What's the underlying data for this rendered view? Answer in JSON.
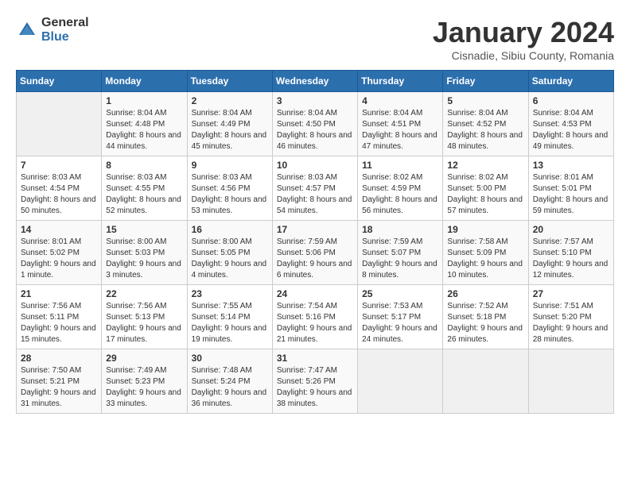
{
  "header": {
    "logo_general": "General",
    "logo_blue": "Blue",
    "title": "January 2024",
    "subtitle": "Cisnadie, Sibiu County, Romania"
  },
  "days_of_week": [
    "Sunday",
    "Monday",
    "Tuesday",
    "Wednesday",
    "Thursday",
    "Friday",
    "Saturday"
  ],
  "weeks": [
    [
      {
        "day": "",
        "sunrise": "",
        "sunset": "",
        "daylight": "",
        "empty": true
      },
      {
        "day": "1",
        "sunrise": "Sunrise: 8:04 AM",
        "sunset": "Sunset: 4:48 PM",
        "daylight": "Daylight: 8 hours and 44 minutes."
      },
      {
        "day": "2",
        "sunrise": "Sunrise: 8:04 AM",
        "sunset": "Sunset: 4:49 PM",
        "daylight": "Daylight: 8 hours and 45 minutes."
      },
      {
        "day": "3",
        "sunrise": "Sunrise: 8:04 AM",
        "sunset": "Sunset: 4:50 PM",
        "daylight": "Daylight: 8 hours and 46 minutes."
      },
      {
        "day": "4",
        "sunrise": "Sunrise: 8:04 AM",
        "sunset": "Sunset: 4:51 PM",
        "daylight": "Daylight: 8 hours and 47 minutes."
      },
      {
        "day": "5",
        "sunrise": "Sunrise: 8:04 AM",
        "sunset": "Sunset: 4:52 PM",
        "daylight": "Daylight: 8 hours and 48 minutes."
      },
      {
        "day": "6",
        "sunrise": "Sunrise: 8:04 AM",
        "sunset": "Sunset: 4:53 PM",
        "daylight": "Daylight: 8 hours and 49 minutes."
      }
    ],
    [
      {
        "day": "7",
        "sunrise": "Sunrise: 8:03 AM",
        "sunset": "Sunset: 4:54 PM",
        "daylight": "Daylight: 8 hours and 50 minutes."
      },
      {
        "day": "8",
        "sunrise": "Sunrise: 8:03 AM",
        "sunset": "Sunset: 4:55 PM",
        "daylight": "Daylight: 8 hours and 52 minutes."
      },
      {
        "day": "9",
        "sunrise": "Sunrise: 8:03 AM",
        "sunset": "Sunset: 4:56 PM",
        "daylight": "Daylight: 8 hours and 53 minutes."
      },
      {
        "day": "10",
        "sunrise": "Sunrise: 8:03 AM",
        "sunset": "Sunset: 4:57 PM",
        "daylight": "Daylight: 8 hours and 54 minutes."
      },
      {
        "day": "11",
        "sunrise": "Sunrise: 8:02 AM",
        "sunset": "Sunset: 4:59 PM",
        "daylight": "Daylight: 8 hours and 56 minutes."
      },
      {
        "day": "12",
        "sunrise": "Sunrise: 8:02 AM",
        "sunset": "Sunset: 5:00 PM",
        "daylight": "Daylight: 8 hours and 57 minutes."
      },
      {
        "day": "13",
        "sunrise": "Sunrise: 8:01 AM",
        "sunset": "Sunset: 5:01 PM",
        "daylight": "Daylight: 8 hours and 59 minutes."
      }
    ],
    [
      {
        "day": "14",
        "sunrise": "Sunrise: 8:01 AM",
        "sunset": "Sunset: 5:02 PM",
        "daylight": "Daylight: 9 hours and 1 minute."
      },
      {
        "day": "15",
        "sunrise": "Sunrise: 8:00 AM",
        "sunset": "Sunset: 5:03 PM",
        "daylight": "Daylight: 9 hours and 3 minutes."
      },
      {
        "day": "16",
        "sunrise": "Sunrise: 8:00 AM",
        "sunset": "Sunset: 5:05 PM",
        "daylight": "Daylight: 9 hours and 4 minutes."
      },
      {
        "day": "17",
        "sunrise": "Sunrise: 7:59 AM",
        "sunset": "Sunset: 5:06 PM",
        "daylight": "Daylight: 9 hours and 6 minutes."
      },
      {
        "day": "18",
        "sunrise": "Sunrise: 7:59 AM",
        "sunset": "Sunset: 5:07 PM",
        "daylight": "Daylight: 9 hours and 8 minutes."
      },
      {
        "day": "19",
        "sunrise": "Sunrise: 7:58 AM",
        "sunset": "Sunset: 5:09 PM",
        "daylight": "Daylight: 9 hours and 10 minutes."
      },
      {
        "day": "20",
        "sunrise": "Sunrise: 7:57 AM",
        "sunset": "Sunset: 5:10 PM",
        "daylight": "Daylight: 9 hours and 12 minutes."
      }
    ],
    [
      {
        "day": "21",
        "sunrise": "Sunrise: 7:56 AM",
        "sunset": "Sunset: 5:11 PM",
        "daylight": "Daylight: 9 hours and 15 minutes."
      },
      {
        "day": "22",
        "sunrise": "Sunrise: 7:56 AM",
        "sunset": "Sunset: 5:13 PM",
        "daylight": "Daylight: 9 hours and 17 minutes."
      },
      {
        "day": "23",
        "sunrise": "Sunrise: 7:55 AM",
        "sunset": "Sunset: 5:14 PM",
        "daylight": "Daylight: 9 hours and 19 minutes."
      },
      {
        "day": "24",
        "sunrise": "Sunrise: 7:54 AM",
        "sunset": "Sunset: 5:16 PM",
        "daylight": "Daylight: 9 hours and 21 minutes."
      },
      {
        "day": "25",
        "sunrise": "Sunrise: 7:53 AM",
        "sunset": "Sunset: 5:17 PM",
        "daylight": "Daylight: 9 hours and 24 minutes."
      },
      {
        "day": "26",
        "sunrise": "Sunrise: 7:52 AM",
        "sunset": "Sunset: 5:18 PM",
        "daylight": "Daylight: 9 hours and 26 minutes."
      },
      {
        "day": "27",
        "sunrise": "Sunrise: 7:51 AM",
        "sunset": "Sunset: 5:20 PM",
        "daylight": "Daylight: 9 hours and 28 minutes."
      }
    ],
    [
      {
        "day": "28",
        "sunrise": "Sunrise: 7:50 AM",
        "sunset": "Sunset: 5:21 PM",
        "daylight": "Daylight: 9 hours and 31 minutes."
      },
      {
        "day": "29",
        "sunrise": "Sunrise: 7:49 AM",
        "sunset": "Sunset: 5:23 PM",
        "daylight": "Daylight: 9 hours and 33 minutes."
      },
      {
        "day": "30",
        "sunrise": "Sunrise: 7:48 AM",
        "sunset": "Sunset: 5:24 PM",
        "daylight": "Daylight: 9 hours and 36 minutes."
      },
      {
        "day": "31",
        "sunrise": "Sunrise: 7:47 AM",
        "sunset": "Sunset: 5:26 PM",
        "daylight": "Daylight: 9 hours and 38 minutes."
      },
      {
        "day": "",
        "sunrise": "",
        "sunset": "",
        "daylight": "",
        "empty": true
      },
      {
        "day": "",
        "sunrise": "",
        "sunset": "",
        "daylight": "",
        "empty": true
      },
      {
        "day": "",
        "sunrise": "",
        "sunset": "",
        "daylight": "",
        "empty": true
      }
    ]
  ]
}
